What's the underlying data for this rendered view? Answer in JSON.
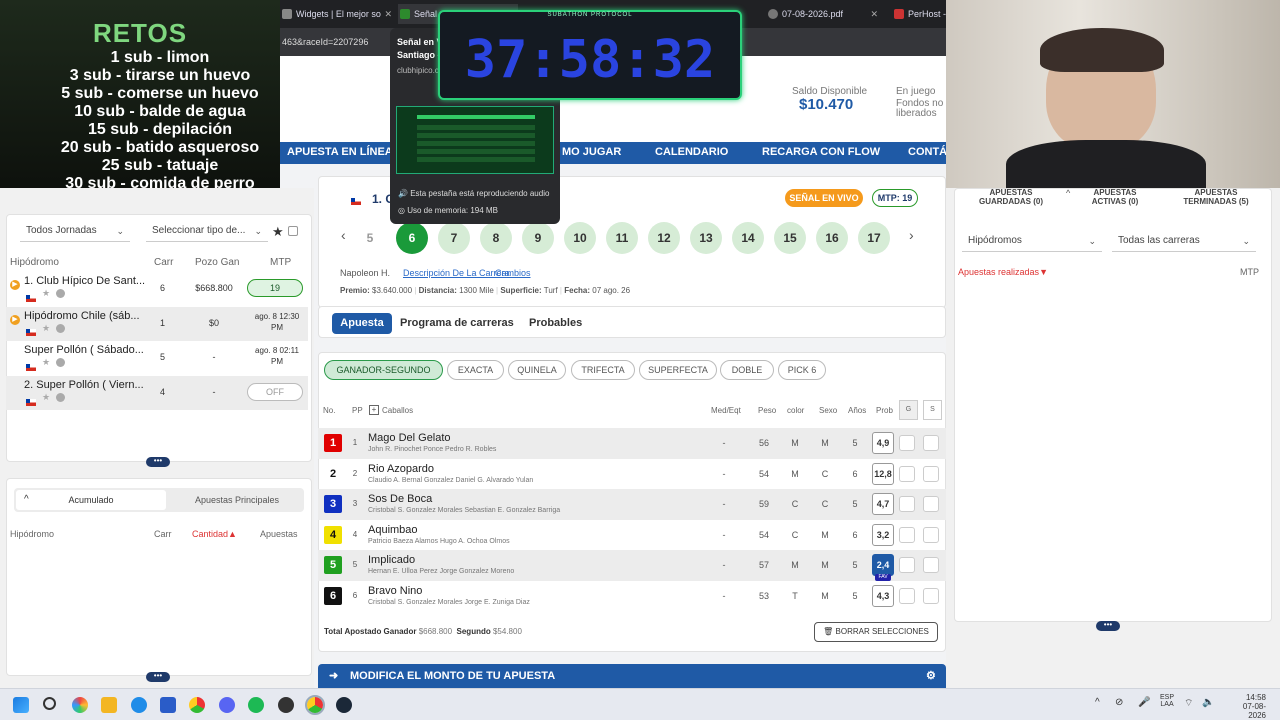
{
  "overlay": {
    "retos_title": "RETOS",
    "retos": [
      "1 sub - limon",
      "3 sub - tirarse un huevo",
      "5 sub - comerse un huevo",
      "10 sub - balde de agua",
      "15 sub - depilación",
      "20 sub - batido asqueroso",
      "25 sub - tatuaje",
      "30 sub - comida de perro",
      "50 sub - rapada al 0"
    ],
    "timer": "37:58:32",
    "timer_caption": "SUBATHON PROTOCOL"
  },
  "browser": {
    "tabs": [
      "Widgets | El mejor so",
      "Señal",
      "",
      "07-08-2026.pdf",
      "PerHost -"
    ],
    "url_fragment": "463&raceId=2207296",
    "tooltip": {
      "title": "Señal en V",
      "line2": "Santiago -",
      "domain": "clubhipico.c",
      "audio": "Esta pestaña está reproduciendo audio",
      "memory": "Uso de memoria: 194 MB"
    }
  },
  "header": {
    "saldo_label": "Saldo Disponible",
    "saldo_value": "$10.470",
    "en_juego": "En juego",
    "fondos": "Fondos no",
    "liberados": "liberados"
  },
  "nav": [
    "APUESTA EN LÍNEA",
    "MO JUGAR",
    "CALENDARIO",
    "RECARGA CON FLOW",
    "CONTÁC"
  ],
  "left": {
    "jornadas": "Todos Jornadas",
    "tipo": "Seleccionar tipo de...",
    "cols": [
      "Hipódromo",
      "Carr",
      "Pozo Gan",
      "MTP"
    ],
    "rows": [
      {
        "name": "1. Club Hípico De Sant...",
        "carr": "6",
        "pozo": "$668.800",
        "mtp": "19"
      },
      {
        "name": "Hipódromo Chile (sáb...",
        "carr": "1",
        "pozo": "$0",
        "mtp": "ago. 8 12:30 PM"
      },
      {
        "name": "Super Pollón ( Sábado...",
        "carr": "5",
        "pozo": "-",
        "mtp": "ago. 8 02:11 PM"
      },
      {
        "name": "2. Super Pollón ( Viern...",
        "carr": "4",
        "pozo": "-",
        "mtp": "OFF"
      }
    ],
    "tab_acumulado": "Acumulado",
    "tab_principales": "Apuestas Principales",
    "cols2": [
      "Hipódromo",
      "Carr",
      "Cantidad",
      "Apuestas"
    ]
  },
  "race": {
    "name": "1. C",
    "live": "SEÑAL EN VIVO",
    "mtp": "MTP: 19",
    "races": [
      "5",
      "6",
      "7",
      "8",
      "9",
      "10",
      "11",
      "12",
      "13",
      "14",
      "15",
      "16",
      "17"
    ],
    "current": "6",
    "judge": "Napoleon H.",
    "desc_link": "Descripción De La Carrera",
    "cambios": "Cambios",
    "premio_label": "Premio:",
    "premio": "$3.640.000",
    "dist_label": "Distancia:",
    "dist": "1300 Mile",
    "sup_label": "Superficie:",
    "sup": "Turf",
    "fecha_label": "Fecha:",
    "fecha": "07 ago. 26",
    "tabs": [
      "Apuesta",
      "Programa de carreras",
      "Probables"
    ],
    "bet_types": [
      "GANADOR-SEGUNDO",
      "EXACTA",
      "QUINELA",
      "TRIFECTA",
      "SUPERFECTA",
      "DOBLE",
      "PICK 6"
    ],
    "cols": [
      "No.",
      "PP",
      "Caballos",
      "Med/Eqt",
      "Peso",
      "color",
      "Sexo",
      "Años",
      "Prob",
      "G",
      "S"
    ],
    "horses": [
      {
        "no": "1",
        "pp": "1",
        "name": "Mago Del Gelato",
        "sub": "John R. Pinochet Ponce   Pedro R. Robles",
        "med": "-",
        "peso": "56",
        "color": "M",
        "sexo": "M",
        "anos": "5",
        "prob": "4,9",
        "bg": "#e00000"
      },
      {
        "no": "2",
        "pp": "2",
        "name": "Rio Azopardo",
        "sub": "Claudio A. Bernal Gonzalez   Daniel G. Alvarado Yulan",
        "med": "-",
        "peso": "54",
        "color": "M",
        "sexo": "C",
        "anos": "6",
        "prob": "12,8",
        "bg": "#ffffff"
      },
      {
        "no": "3",
        "pp": "3",
        "name": "Sos De Boca",
        "sub": "Cristobal S. Gonzalez Morales   Sebastian E. Gonzalez Barriga",
        "med": "-",
        "peso": "59",
        "color": "C",
        "sexo": "C",
        "anos": "5",
        "prob": "4,7",
        "bg": "#1030c0"
      },
      {
        "no": "4",
        "pp": "4",
        "name": "Aquimbao",
        "sub": "Patricio Baeza Alamos   Hugo A. Ochoa Olmos",
        "med": "-",
        "peso": "54",
        "color": "C",
        "sexo": "M",
        "anos": "6",
        "prob": "3,2",
        "bg": "#f0e000"
      },
      {
        "no": "5",
        "pp": "5",
        "name": "Implicado",
        "sub": "Hernan E. Ulloa Perez   Jorge Gonzalez Moreno",
        "med": "-",
        "peso": "57",
        "color": "M",
        "sexo": "M",
        "anos": "5",
        "prob": "2,4",
        "bg": "#20a020"
      },
      {
        "no": "6",
        "pp": "6",
        "name": "Bravo Nino",
        "sub": "Cristobal S. Gonzalez Morales   Jorge E. Zuniga Diaz",
        "med": "-",
        "peso": "53",
        "color": "T",
        "sexo": "M",
        "anos": "5",
        "prob": "4,3",
        "bg": "#111111"
      }
    ],
    "fav": "FAV",
    "total_label": "Total Apostado Ganador",
    "total": "$668.800",
    "segundo_label": "Segundo",
    "segundo": "$54.800",
    "borrar": "BORRAR SELECCIONES",
    "modifica": "MODIFICA EL MONTO DE TU APUESTA"
  },
  "right": {
    "tabs": [
      "APUESTAS GUARDADAS (0)",
      "APUESTAS ACTIVAS (0)",
      "APUESTAS TERMINADAS (5)"
    ],
    "hipodromos": "Hipódromos",
    "carreras": "Todas las carreras",
    "realizadas": "Apuestas realizadas",
    "mtp": "MTP"
  },
  "taskbar": {
    "lang": "ESP",
    "lang2": "LAA",
    "time": "14:58",
    "date": "07-08-2026"
  }
}
